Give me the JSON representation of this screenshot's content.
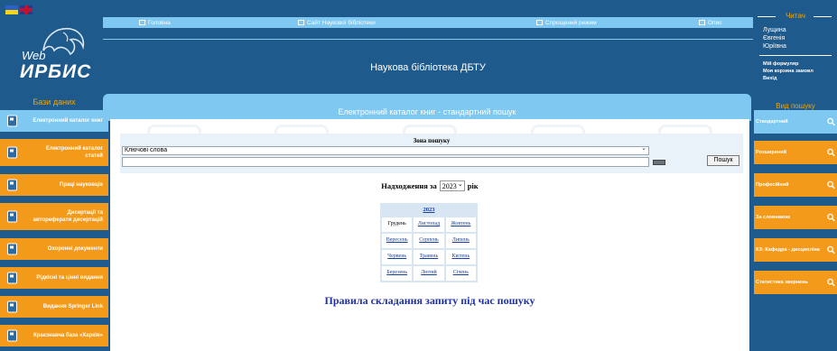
{
  "flags": [
    "Українська",
    "English"
  ],
  "logo": {
    "web": "Web",
    "irbis": "ИРБИС"
  },
  "left": {
    "title": "Бази даних",
    "items": [
      "Електронний каталог книг",
      "Електронний каталог статей",
      "Праці науковців",
      "Дисертації та автореферати дисертацій",
      "Охоронні документи",
      "Рідкісні та цінні видання",
      "Видання Springer Link",
      "Краєзнавча база «Харків»"
    ]
  },
  "nav": [
    "Головна",
    "Сайт Наукової бібліотеки",
    "Спрощений режим",
    "Опис"
  ],
  "banner": {
    "title": "Наукова бібліотека ДБТУ"
  },
  "panel": {
    "title": "Електронний каталог книг - стандартний пошук",
    "zone_label": "Зона пошуку",
    "zone_value": "Ключові слова",
    "search_button": "Пошук",
    "arrivals_prefix": "Надходження за",
    "arrivals_year": "2023",
    "arrivals_suffix": "рік",
    "calendar": {
      "year": "2023",
      "months": [
        [
          "Грудень",
          "Листопад",
          "Жовтень"
        ],
        [
          "Вересень",
          "Серпень",
          "Липень"
        ],
        [
          "Червень",
          "Травень",
          "Квітень"
        ],
        [
          "Березень",
          "Лютий",
          "Січень"
        ]
      ]
    },
    "rules_link": "Правила складання запиту під час пошуку"
  },
  "reader": {
    "title": "Читач",
    "name_lines": [
      "Лущина",
      "Євгенія",
      "Юріївна"
    ],
    "links": [
      "Мій формуляр",
      "Моя корзина замовл",
      "Вихід"
    ]
  },
  "modes": {
    "title": "Вид пошуку",
    "items": [
      "Стандартний",
      "Розширений",
      "Професійний",
      "За словником",
      "КЗ: Кафедра - дисципліна",
      "Статистика звернень"
    ]
  },
  "colors": {
    "background": "#1f5a8c",
    "accent_orange": "#f49a1a",
    "accent_blue": "#7ec8f2",
    "link": "#1d2fa8"
  }
}
